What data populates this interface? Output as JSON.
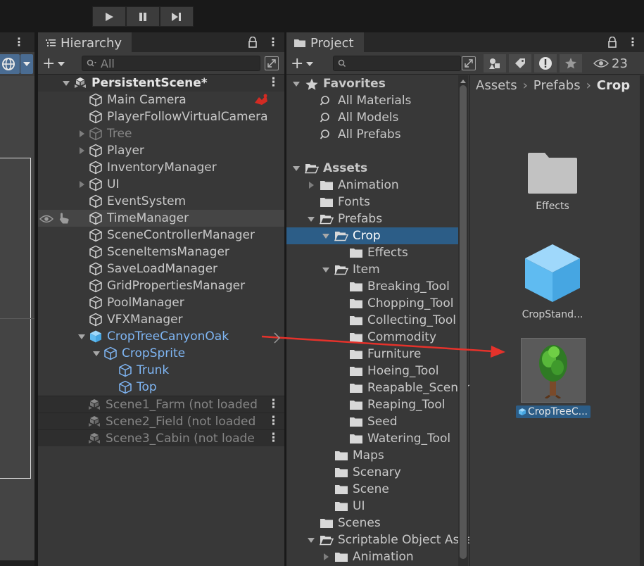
{
  "toolbar": {
    "buttons": [
      {
        "name": "play-button",
        "icon": "play-icon"
      },
      {
        "name": "pause-button",
        "icon": "pause-icon"
      },
      {
        "name": "step-button",
        "icon": "step-icon"
      }
    ]
  },
  "hierarchy": {
    "tab_label": "Hierarchy",
    "search_placeholder": "All",
    "items": [
      {
        "label": "PersistentScene*",
        "depth": 0,
        "arrow": "down",
        "kind": "scene",
        "bold": true
      },
      {
        "label": "Main Camera",
        "depth": 1,
        "arrow": "",
        "kind": "go"
      },
      {
        "label": "PlayerFollowVirtualCamera",
        "depth": 1,
        "arrow": "",
        "kind": "go"
      },
      {
        "label": "Tree",
        "depth": 1,
        "arrow": "right",
        "kind": "go",
        "dim": true
      },
      {
        "label": "Player",
        "depth": 1,
        "arrow": "right",
        "kind": "go"
      },
      {
        "label": "InventoryManager",
        "depth": 1,
        "arrow": "",
        "kind": "go"
      },
      {
        "label": "UI",
        "depth": 1,
        "arrow": "right",
        "kind": "go"
      },
      {
        "label": "EventSystem",
        "depth": 1,
        "arrow": "",
        "kind": "go"
      },
      {
        "label": "TimeManager",
        "depth": 1,
        "arrow": "",
        "kind": "go",
        "hover": true
      },
      {
        "label": "SceneControllerManager",
        "depth": 1,
        "arrow": "",
        "kind": "go"
      },
      {
        "label": "SceneItemsManager",
        "depth": 1,
        "arrow": "",
        "kind": "go"
      },
      {
        "label": "SaveLoadManager",
        "depth": 1,
        "arrow": "",
        "kind": "go"
      },
      {
        "label": "GridPropertiesManager",
        "depth": 1,
        "arrow": "",
        "kind": "go"
      },
      {
        "label": "PoolManager",
        "depth": 1,
        "arrow": "",
        "kind": "go"
      },
      {
        "label": "VFXManager",
        "depth": 1,
        "arrow": "",
        "kind": "go"
      },
      {
        "label": "CropTreeCanyonOak",
        "depth": 1,
        "arrow": "down",
        "kind": "prefab",
        "blue": true
      },
      {
        "label": "CropSprite",
        "depth": 2,
        "arrow": "down",
        "kind": "go",
        "blue": true
      },
      {
        "label": "Trunk",
        "depth": 3,
        "arrow": "",
        "kind": "go",
        "blue": true
      },
      {
        "label": "Top",
        "depth": 3,
        "arrow": "",
        "kind": "go",
        "blue": true
      },
      {
        "label": "Scene1_Farm (not loaded",
        "depth": 0,
        "arrow": "",
        "kind": "scene-unloaded",
        "dim": true
      },
      {
        "label": "Scene2_Field (not loaded",
        "depth": 0,
        "arrow": "",
        "kind": "scene-unloaded",
        "dim": true
      },
      {
        "label": "Scene3_Cabin (not loade",
        "depth": 0,
        "arrow": "",
        "kind": "scene-unloaded",
        "dim": true
      }
    ]
  },
  "project": {
    "tab_label": "Project",
    "hidden_count": "23",
    "breadcrumb": [
      "Assets",
      "Prefabs",
      "Crop"
    ],
    "tree": [
      {
        "label": "Favorites",
        "depth": 0,
        "arrow": "down",
        "icon": "star",
        "bold": true
      },
      {
        "label": "All Materials",
        "depth": 1,
        "arrow": "",
        "icon": "search"
      },
      {
        "label": "All Models",
        "depth": 1,
        "arrow": "",
        "icon": "search"
      },
      {
        "label": "All Prefabs",
        "depth": 1,
        "arrow": "",
        "icon": "search"
      },
      {
        "label": "",
        "depth": 0,
        "arrow": "",
        "icon": "none"
      },
      {
        "label": "Assets",
        "depth": 0,
        "arrow": "down",
        "icon": "folder-open",
        "bold": true
      },
      {
        "label": "Animation",
        "depth": 1,
        "arrow": "right",
        "icon": "folder"
      },
      {
        "label": "Fonts",
        "depth": 1,
        "arrow": "",
        "icon": "folder"
      },
      {
        "label": "Prefabs",
        "depth": 1,
        "arrow": "down",
        "icon": "folder-open"
      },
      {
        "label": "Crop",
        "depth": 2,
        "arrow": "down",
        "icon": "folder-open",
        "selected": true
      },
      {
        "label": "Effects",
        "depth": 3,
        "arrow": "",
        "icon": "folder"
      },
      {
        "label": "Item",
        "depth": 2,
        "arrow": "down",
        "icon": "folder-open"
      },
      {
        "label": "Breaking_Tool",
        "depth": 3,
        "arrow": "",
        "icon": "folder"
      },
      {
        "label": "Chopping_Tool",
        "depth": 3,
        "arrow": "",
        "icon": "folder"
      },
      {
        "label": "Collecting_Tool",
        "depth": 3,
        "arrow": "",
        "icon": "folder"
      },
      {
        "label": "Commodity",
        "depth": 3,
        "arrow": "",
        "icon": "folder"
      },
      {
        "label": "Furniture",
        "depth": 3,
        "arrow": "",
        "icon": "folder"
      },
      {
        "label": "Hoeing_Tool",
        "depth": 3,
        "arrow": "",
        "icon": "folder"
      },
      {
        "label": "Reapable_Scenary",
        "depth": 3,
        "arrow": "",
        "icon": "folder"
      },
      {
        "label": "Reaping_Tool",
        "depth": 3,
        "arrow": "",
        "icon": "folder"
      },
      {
        "label": "Seed",
        "depth": 3,
        "arrow": "",
        "icon": "folder"
      },
      {
        "label": "Watering_Tool",
        "depth": 3,
        "arrow": "",
        "icon": "folder"
      },
      {
        "label": "Maps",
        "depth": 2,
        "arrow": "",
        "icon": "folder"
      },
      {
        "label": "Scenary",
        "depth": 2,
        "arrow": "",
        "icon": "folder"
      },
      {
        "label": "Scene",
        "depth": 2,
        "arrow": "",
        "icon": "folder"
      },
      {
        "label": "UI",
        "depth": 2,
        "arrow": "",
        "icon": "folder"
      },
      {
        "label": "Scenes",
        "depth": 1,
        "arrow": "",
        "icon": "folder"
      },
      {
        "label": "Scriptable Object Assets",
        "depth": 1,
        "arrow": "down",
        "icon": "folder-open"
      },
      {
        "label": "Animation",
        "depth": 2,
        "arrow": "right",
        "icon": "folder"
      }
    ],
    "assets": [
      {
        "label": "Effects",
        "kind": "folder"
      },
      {
        "label": "CropStand...",
        "kind": "prefab-cube"
      },
      {
        "label": "CropTreeC...",
        "kind": "prefab-tree"
      }
    ]
  },
  "colors": {
    "selection": "#2c5d87",
    "prefab_blue": "#7fb6f4",
    "drag_arrow": "#e5322b"
  }
}
